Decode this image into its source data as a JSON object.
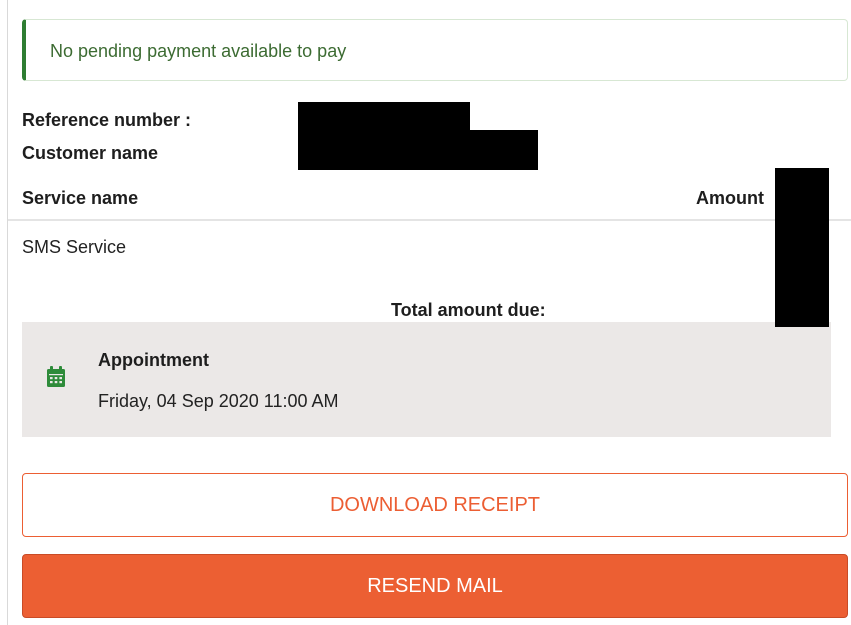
{
  "alert": {
    "message": "No pending payment available to pay",
    "accent_color": "#2e7d32"
  },
  "details": {
    "reference_label": "Reference number :",
    "customer_label": "Customer name"
  },
  "table": {
    "col_service": "Service name",
    "col_amount": "Amount",
    "rows": [
      {
        "service": "SMS Service"
      }
    ],
    "total_label": "Total amount due:"
  },
  "appointment": {
    "title": "Appointment",
    "datetime": "Friday, 04 Sep 2020 11:00 AM",
    "icon": "calendar-icon",
    "icon_color": "#2e8b3a"
  },
  "actions": {
    "download_label": "DOWNLOAD RECEIPT",
    "resend_label": "RESEND MAIL",
    "brand_color": "#ec5f33"
  }
}
